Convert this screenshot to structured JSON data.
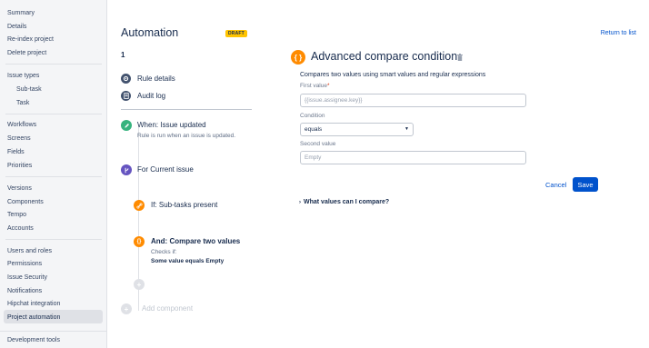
{
  "sidebar": {
    "items": [
      {
        "label": "Summary"
      },
      {
        "label": "Details"
      },
      {
        "label": "Re-index project"
      },
      {
        "label": "Delete project"
      },
      {
        "label": "Issue types"
      },
      {
        "label": "Sub-task"
      },
      {
        "label": "Task"
      },
      {
        "label": "Workflows"
      },
      {
        "label": "Screens"
      },
      {
        "label": "Fields"
      },
      {
        "label": "Priorities"
      },
      {
        "label": "Versions"
      },
      {
        "label": "Components"
      },
      {
        "label": "Tempo"
      },
      {
        "label": "Accounts"
      },
      {
        "label": "Users and roles"
      },
      {
        "label": "Permissions"
      },
      {
        "label": "Issue Security"
      },
      {
        "label": "Notifications"
      },
      {
        "label": "Hipchat integration"
      },
      {
        "label": "Project automation"
      },
      {
        "label": "Development tools"
      }
    ]
  },
  "header": {
    "title": "Automation",
    "badge": "DRAFT",
    "return_link": "Return to list",
    "rule_number": "1"
  },
  "nav": {
    "rule_details": "Rule details",
    "audit_log": "Audit log"
  },
  "timeline": {
    "trigger": {
      "title": "When: Issue updated",
      "subtitle": "Rule is run when an issue is updated."
    },
    "branch": {
      "title": "For Current issue"
    },
    "condition1": {
      "title": "If: Sub-tasks present"
    },
    "condition2": {
      "title": "And: Compare two values",
      "subtitle": "Checks if:",
      "detail": "Some value equals Empty"
    },
    "add_component": "Add component"
  },
  "panel": {
    "icon_glyph": "{ }",
    "title": "Advanced compare condition",
    "description": "Compares two values using smart values and regular expressions",
    "first_value_label": "First value",
    "required_mark": "*",
    "first_value_placeholder": "{{issue.assignee.key}}",
    "condition_label": "Condition",
    "condition_value": "equals",
    "second_value_label": "Second value",
    "second_value_placeholder": "Empty",
    "cancel_label": "Cancel",
    "save_label": "Save",
    "help_label": "What values can I compare?"
  },
  "colors": {
    "accent": "#0052cc",
    "draft": "#ffc400",
    "trigger": "#36b37e",
    "branch": "#6554c0",
    "condition": "#ff8b00",
    "nav_icon": "#42526e"
  },
  "icons": {
    "rule_details": "gear-icon",
    "audit_log": "document-icon",
    "trigger": "pencil-icon",
    "branch": "branch-icon",
    "condition1": "link-icon",
    "condition2": "braces-icon",
    "delete": "trash-icon",
    "add": "plus-icon"
  }
}
